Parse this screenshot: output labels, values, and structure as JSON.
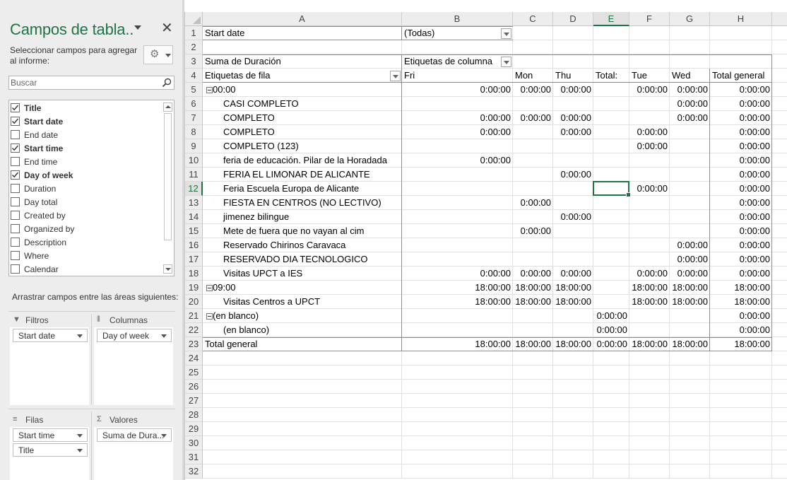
{
  "pane": {
    "title": "Campos de tabla..",
    "instruction": "Seleccionar campos para agregar al informe:",
    "search_placeholder": "Buscar",
    "fields": [
      {
        "label": "Title",
        "checked": true
      },
      {
        "label": "Start date",
        "checked": true
      },
      {
        "label": "End date",
        "checked": false
      },
      {
        "label": "Start time",
        "checked": true
      },
      {
        "label": "End time",
        "checked": false
      },
      {
        "label": "Day of week",
        "checked": true
      },
      {
        "label": "Duration",
        "checked": false
      },
      {
        "label": "Day total",
        "checked": false
      },
      {
        "label": "Created by",
        "checked": false
      },
      {
        "label": "Organized by",
        "checked": false
      },
      {
        "label": "Description",
        "checked": false
      },
      {
        "label": "Where",
        "checked": false
      },
      {
        "label": "Calendar",
        "checked": false
      }
    ],
    "areas_label": "Arrastrar campos entre las áreas siguientes:",
    "areas": {
      "filters": {
        "title": "Filtros",
        "chips": [
          "Start date"
        ]
      },
      "columns": {
        "title": "Columnas",
        "chips": [
          "Day of week"
        ]
      },
      "rows": {
        "title": "Filas",
        "chips": [
          "Start time",
          "Title"
        ]
      },
      "values": {
        "title": "Valores",
        "chips": [
          "Suma de Dura..."
        ]
      }
    },
    "accent_color": "#217346"
  },
  "sheet": {
    "columns": [
      "A",
      "B",
      "C",
      "D",
      "E",
      "F",
      "G",
      "H"
    ],
    "selected_column": "E",
    "selected_row": 12,
    "row_numbers": [
      1,
      2,
      3,
      4,
      5,
      6,
      7,
      8,
      9,
      10,
      11,
      12,
      13,
      14,
      15,
      16,
      17,
      18,
      19,
      20,
      21,
      22,
      23,
      24,
      25,
      26,
      27,
      28,
      29,
      30,
      31,
      32
    ],
    "filter": {
      "label": "Start date",
      "value": "(Todas)"
    },
    "values_label": "Suma de Duración",
    "col_labels_header": "Etiquetas de columna",
    "row_labels_header": "Etiquetas de fila",
    "day_headers": [
      "Fri",
      "Mon",
      "Thu",
      "Total:",
      "Tue",
      "Wed",
      "Total general"
    ],
    "rows": [
      {
        "label": "00:00",
        "group": true,
        "vals": [
          "0:00:00",
          "0:00:00",
          "0:00:00",
          "",
          "0:00:00",
          "0:00:00",
          "0:00:00"
        ]
      },
      {
        "label": "CASI COMPLETO",
        "vals": [
          "",
          "",
          "",
          "",
          "",
          "0:00:00",
          "0:00:00"
        ]
      },
      {
        "label": "COMPLETO",
        "vals": [
          "0:00:00",
          "0:00:00",
          "0:00:00",
          "",
          "",
          "0:00:00",
          "0:00:00"
        ]
      },
      {
        "label": "COMPLETO",
        "vals": [
          "0:00:00",
          "",
          "0:00:00",
          "",
          "0:00:00",
          "",
          "0:00:00"
        ]
      },
      {
        "label": "COMPLETO (123)",
        "vals": [
          "",
          "",
          "",
          "",
          "0:00:00",
          "",
          "0:00:00"
        ]
      },
      {
        "label": "feria de educación. Pilar de la Horadada",
        "vals": [
          "0:00:00",
          "",
          "",
          "",
          "",
          "",
          "0:00:00"
        ]
      },
      {
        "label": "FERIA EL LIMONAR DE ALICANTE",
        "vals": [
          "",
          "",
          "0:00:00",
          "",
          "",
          "",
          "0:00:00"
        ]
      },
      {
        "label": "Feria Escuela Europa de Alicante",
        "vals": [
          "",
          "",
          "",
          "",
          "0:00:00",
          "",
          "0:00:00"
        ]
      },
      {
        "label": "FIESTA EN CENTROS (NO LECTIVO)",
        "vals": [
          "",
          "0:00:00",
          "",
          "",
          "",
          "",
          "0:00:00"
        ]
      },
      {
        "label": "jimenez bilingue",
        "vals": [
          "",
          "",
          "0:00:00",
          "",
          "",
          "",
          "0:00:00"
        ]
      },
      {
        "label": "Mete de fuera que no vayan al cim",
        "vals": [
          "",
          "0:00:00",
          "",
          "",
          "",
          "",
          "0:00:00"
        ]
      },
      {
        "label": "Reservado Chirinos Caravaca",
        "vals": [
          "",
          "",
          "",
          "",
          "",
          "0:00:00",
          "0:00:00"
        ]
      },
      {
        "label": "RESERVADO DIA TECNOLOGICO",
        "vals": [
          "",
          "",
          "",
          "",
          "",
          "0:00:00",
          "0:00:00"
        ]
      },
      {
        "label": "Visitas UPCT a IES",
        "vals": [
          "0:00:00",
          "0:00:00",
          "0:00:00",
          "",
          "0:00:00",
          "0:00:00",
          "0:00:00"
        ]
      },
      {
        "label": "09:00",
        "group": true,
        "vals": [
          "18:00:00",
          "18:00:00",
          "18:00:00",
          "",
          "18:00:00",
          "18:00:00",
          "18:00:00"
        ]
      },
      {
        "label": "Visitas Centros a UPCT",
        "vals": [
          "18:00:00",
          "18:00:00",
          "18:00:00",
          "",
          "18:00:00",
          "18:00:00",
          "18:00:00"
        ]
      },
      {
        "label": "(en blanco)",
        "group": true,
        "vals": [
          "",
          "",
          "",
          "0:00:00",
          "",
          "",
          "0:00:00"
        ]
      },
      {
        "label": "(en blanco)",
        "vals": [
          "",
          "",
          "",
          "0:00:00",
          "",
          "",
          "0:00:00"
        ]
      }
    ],
    "grand_total": {
      "label": "Total general",
      "vals": [
        "18:00:00",
        "18:00:00",
        "18:00:00",
        "0:00:00",
        "18:00:00",
        "18:00:00",
        "18:00:00"
      ]
    }
  }
}
